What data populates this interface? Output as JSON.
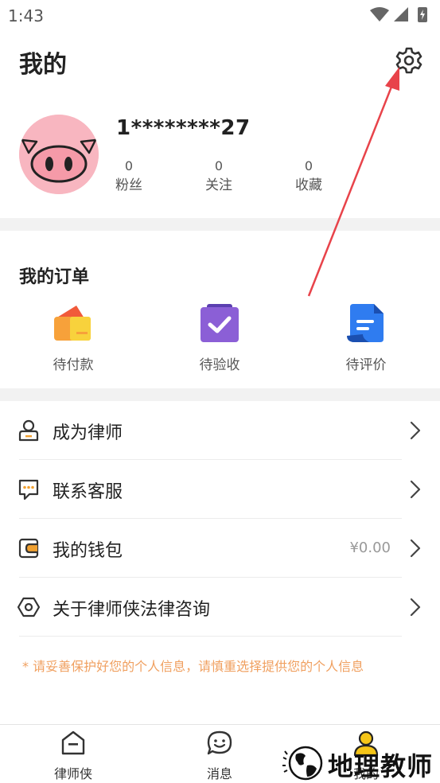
{
  "status_bar": {
    "time": "1:43"
  },
  "header": {
    "title": "我的",
    "username": "1********27",
    "stats": [
      {
        "value": "0",
        "label": "粉丝"
      },
      {
        "value": "0",
        "label": "关注"
      },
      {
        "value": "0",
        "label": "收藏"
      }
    ]
  },
  "orders": {
    "title": "我的订单",
    "items": [
      {
        "label": "待付款",
        "icon": "wallet-card-icon"
      },
      {
        "label": "待验收",
        "icon": "checkbox-icon"
      },
      {
        "label": "待评价",
        "icon": "document-icon"
      }
    ]
  },
  "menu": {
    "items": [
      {
        "label": "成为律师",
        "icon": "user-badge-icon"
      },
      {
        "label": "联系客服",
        "icon": "chat-bubble-icon"
      },
      {
        "label": "我的钱包",
        "icon": "wallet-icon",
        "value": "¥0.00"
      },
      {
        "label": "关于律师侠法律咨询",
        "icon": "hexagon-icon"
      }
    ],
    "privacy_note": "* 请妥善保护好您的个人信息，请慎重选择提供您的个人信息"
  },
  "tabbar": {
    "tabs": [
      {
        "label": "律师侠",
        "icon": "home-icon"
      },
      {
        "label": "消息",
        "icon": "message-icon"
      },
      {
        "label": "我的",
        "icon": "profile-icon"
      }
    ]
  },
  "watermark": {
    "text": "地理教师"
  },
  "colors": {
    "accent": "#f0a060",
    "arrow": "#e8434a",
    "avatar_bg": "#f8b6c0"
  }
}
